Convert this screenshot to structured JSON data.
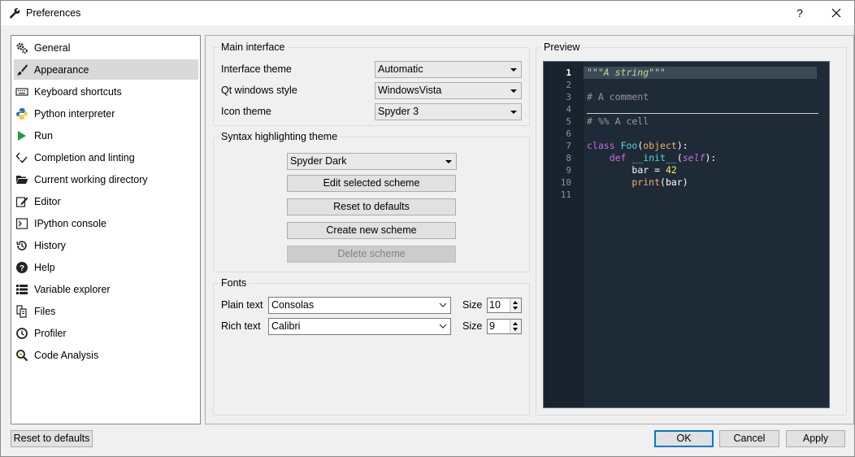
{
  "window": {
    "title": "Preferences",
    "help_label": "?"
  },
  "sidebar": {
    "items": [
      {
        "label": "General",
        "icon": "gears-icon"
      },
      {
        "label": "Appearance",
        "icon": "paint-brush-icon"
      },
      {
        "label": "Keyboard shortcuts",
        "icon": "keyboard-icon"
      },
      {
        "label": "Python interpreter",
        "icon": "python-icon"
      },
      {
        "label": "Run",
        "icon": "play-icon"
      },
      {
        "label": "Completion and linting",
        "icon": "completion-icon"
      },
      {
        "label": "Current working directory",
        "icon": "folder-open-icon"
      },
      {
        "label": "Editor",
        "icon": "edit-icon"
      },
      {
        "label": "IPython console",
        "icon": "terminal-icon"
      },
      {
        "label": "History",
        "icon": "history-icon"
      },
      {
        "label": "Help",
        "icon": "question-circle-icon"
      },
      {
        "label": "Variable explorer",
        "icon": "table-list-icon"
      },
      {
        "label": "Files",
        "icon": "files-icon"
      },
      {
        "label": "Profiler",
        "icon": "clock-icon"
      },
      {
        "label": "Code Analysis",
        "icon": "code-analysis-icon"
      }
    ],
    "selected_index": 1
  },
  "main_interface": {
    "group_label": "Main interface",
    "interface_theme": {
      "label": "Interface theme",
      "value": "Automatic"
    },
    "qt_style": {
      "label": "Qt windows style",
      "value": "WindowsVista"
    },
    "icon_theme": {
      "label": "Icon theme",
      "value": "Spyder 3"
    }
  },
  "syntax": {
    "group_label": "Syntax highlighting theme",
    "scheme_value": "Spyder Dark",
    "edit_label": "Edit selected scheme",
    "reset_label": "Reset to defaults",
    "create_label": "Create new scheme",
    "delete_label": "Delete scheme"
  },
  "fonts": {
    "group_label": "Fonts",
    "plain": {
      "label": "Plain text",
      "font": "Consolas",
      "size_label": "Size",
      "size": "10"
    },
    "rich": {
      "label": "Rich text",
      "font": "Calibri",
      "size_label": "Size",
      "size": "9"
    }
  },
  "preview": {
    "label": "Preview",
    "line_numbers": [
      "1",
      "2",
      "3",
      "4",
      "5",
      "6",
      "7",
      "8",
      "9",
      "10",
      "11"
    ],
    "current_line": "1",
    "code": {
      "l1": "\"\"\"A string\"\"\"",
      "l3": "# A comment",
      "l5": "# %% A cell",
      "l7_kw": "class",
      "l7_name": "Foo",
      "l7_rest_open": "(",
      "l7_base": "object",
      "l7_rest_close": "):",
      "l8_kw": "def",
      "l8_name": "__init__",
      "l8_open": "(",
      "l8_self": "self",
      "l8_close": "):",
      "l9_var": "bar = ",
      "l9_num": "42",
      "l10_fn": "print",
      "l10_rest": "(bar)"
    },
    "colors": {
      "background": "#19232d",
      "string": "#b0e686",
      "comment": "#999999",
      "keyword": "#c670e0",
      "definition": "#57d6e4",
      "builtin": "#fab16c",
      "number": "#faed5c"
    }
  },
  "footer": {
    "reset_label": "Reset to defaults",
    "ok_label": "OK",
    "cancel_label": "Cancel",
    "apply_label": "Apply"
  }
}
